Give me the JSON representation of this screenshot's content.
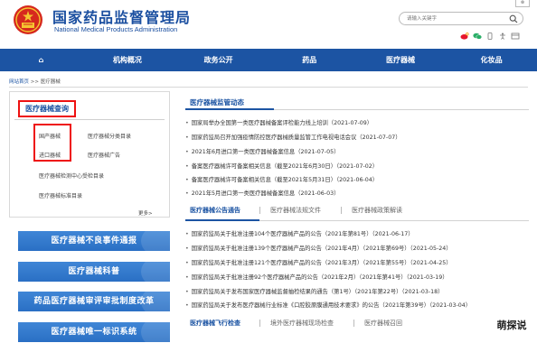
{
  "header": {
    "title_cn": "国家药品监督管理局",
    "title_en": "National Medical Products Administration",
    "search_placeholder": "请输入关键字",
    "app_corner_label": "⊗"
  },
  "nav": {
    "items": [
      "⌂",
      "机构概况",
      "政务公开",
      "药品",
      "医疗器械",
      "化妆品"
    ]
  },
  "breadcrumb": {
    "home": "网站首页",
    "sep": " >> ",
    "current": "医疗器械"
  },
  "left_panel": {
    "title": "医疗器械查询",
    "links": [
      "国产器械",
      "医疗器械分类目录",
      "进口器械",
      "医疗器械广告",
      "医疗器械检测中心受检目录",
      "医疗器械标准目录"
    ],
    "more": "更多>"
  },
  "banners": [
    "医疗器械不良事件通报",
    "医疗器械科普",
    "药品医疗器械审评审批制度改革",
    "医疗器械唯一标识系统"
  ],
  "section1": {
    "title": "医疗器械监管动态",
    "items": [
      "国家局举办全国第一类医疗器械备案评检能力线上培训（2021-07-09）",
      "国家药监局召开加强疫情防控医疗器械质量监管工作电视电话会议（2021-07-07）",
      "2021年6月进口第一类医疗器械备案信息（2021-07-05）",
      "备案医疗器械许可备案相关信息（截至2021年6月30日）（2021-07-02）",
      "备案医疗器械许可备案相关信息（截至2021年5月31日）（2021-06-04）",
      "2021年5月进口第一类医疗器械备案信息（2021-06-03）"
    ]
  },
  "tabs": {
    "items": [
      "医疗器械公告通告",
      "医疗器械法规文件",
      "医疗器械政策解读"
    ]
  },
  "section2": {
    "items": [
      "国家药监局关于批准注册104个医疗器械产品的公告（2021年第81号）（2021-06-17）",
      "国家药监局关于批准注册139个医疗器械产品的公告（2021年4月）（2021年第69号）（2021-05-24）",
      "国家药监局关于批准注册121个医疗器械产品的公告（2021年3月）（2021年第55号）（2021-04-25）",
      "国家药监局关于批准注册92个医疗器械产品的公告（2021年2月）（2021年第41号）（2021-03-19）",
      "国家药监局关于发布国家医疗器械监督抽检结果的通告（第1号）（2021年第22号）（2021-03-18）",
      "国家药监局关于发布医疗器械行业标准《口腔胶原膜通用技术要求》的公告（2021年第39号）（2021-03-04）"
    ]
  },
  "tabs2": {
    "items": [
      "医疗器械飞行检查",
      "境外医疗器械现场检查",
      "医疗器械召回"
    ]
  },
  "watermark": "萌探说"
}
